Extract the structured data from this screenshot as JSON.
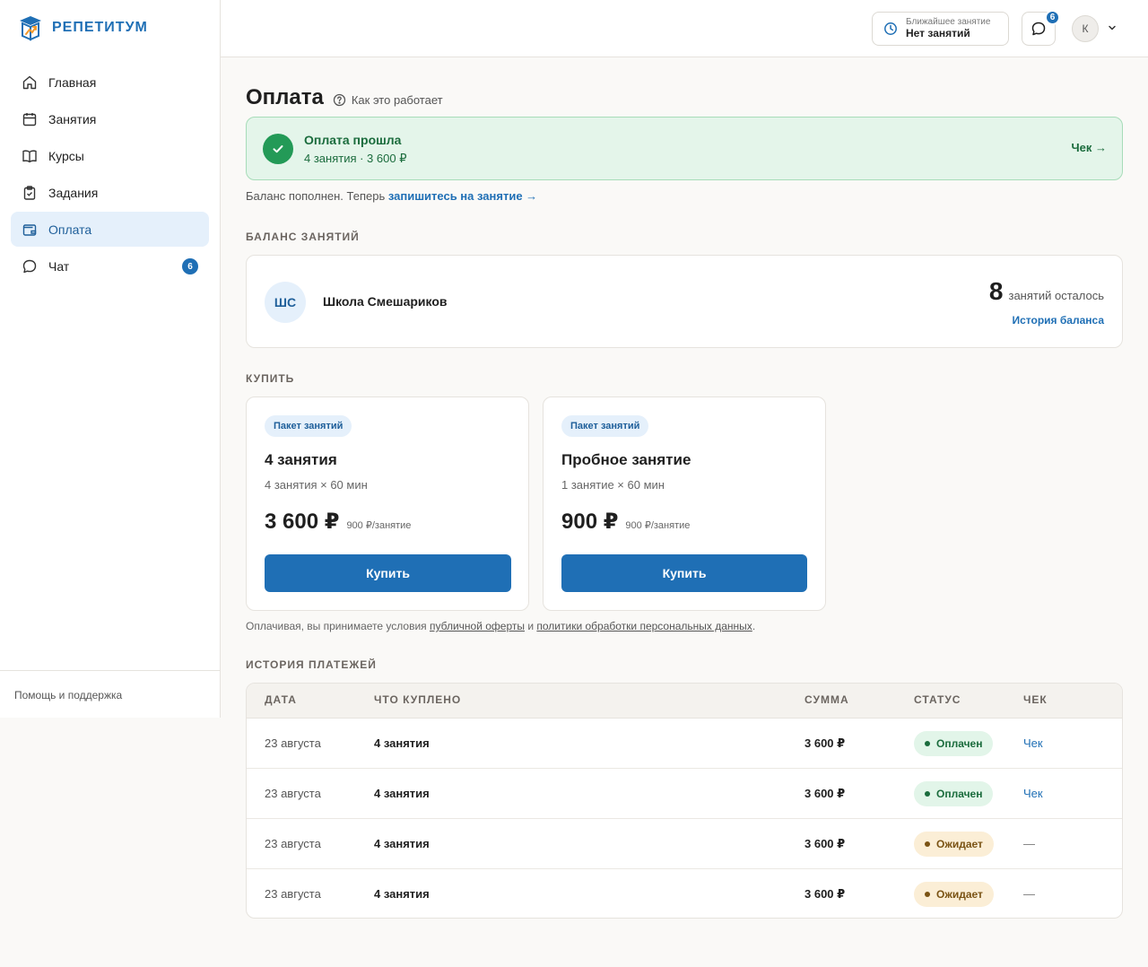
{
  "brand": {
    "name": "РЕПЕТИТУМ",
    "color": "#1f6fb5"
  },
  "sidebar": {
    "items": [
      {
        "label": "Главная",
        "icon": "home-icon"
      },
      {
        "label": "Занятия",
        "icon": "calendar-icon"
      },
      {
        "label": "Курсы",
        "icon": "book-icon"
      },
      {
        "label": "Задания",
        "icon": "clipboard-icon"
      },
      {
        "label": "Оплата",
        "icon": "wallet-icon",
        "active": true
      },
      {
        "label": "Чат",
        "icon": "chat-icon",
        "badge": "6"
      }
    ],
    "footer": "Помощь и поддержка"
  },
  "topbar": {
    "next_lesson_label": "Ближайшее занятие",
    "next_lesson_value": "Нет занятий",
    "chat_badge": "6",
    "avatar_initial": "К"
  },
  "page": {
    "title": "Оплата",
    "how_link": "Как это работает"
  },
  "success": {
    "title": "Оплата прошла",
    "subtitle": "4 занятия · 3 600 ₽",
    "receipt_link": "Чек →"
  },
  "balance_note": {
    "text": "Баланс пополнен. Теперь",
    "link": "запишитесь на занятие →"
  },
  "balance": {
    "section_label": "БАЛАНС ЗАНЯТИЙ",
    "school_initials": "ШС",
    "school_name": "Школа Смешариков",
    "count": "8",
    "count_label": "занятий осталось",
    "history_link": "История баланса"
  },
  "buy": {
    "section_label": "КУПИТЬ",
    "packages": [
      {
        "tag": "Пакет занятий",
        "title": "4 занятия",
        "sub": "4 занятия × 60 мин",
        "price": "3 600 ₽",
        "per": "900 ₽/занятие",
        "button": "Купить"
      },
      {
        "tag": "Пакет занятий",
        "title": "Пробное занятие",
        "sub": "1 занятие × 60 мин",
        "price": "900 ₽",
        "per": "900 ₽/занятие",
        "button": "Купить"
      }
    ],
    "terms_prefix": "Оплачивая, вы принимаете условия",
    "terms_link1": "публичной оферты",
    "terms_and": "и",
    "terms_link2": "политики обработки персональных данных",
    "terms_suffix": "."
  },
  "history": {
    "section_label": "ИСТОРИЯ ПЛАТЕЖЕЙ",
    "columns": [
      "ДАТА",
      "ЧТО КУПЛЕНО",
      "СУММА",
      "СТАТУС",
      "ЧЕК"
    ],
    "rows": [
      {
        "date": "23 августа",
        "item": "4 занятия",
        "sum": "3 600 ₽",
        "status": "Оплачен",
        "check": "Чек"
      },
      {
        "date": "23 августа",
        "item": "4 занятия",
        "sum": "3 600 ₽",
        "status": "Оплачен",
        "check": "Чек"
      },
      {
        "date": "23 августа",
        "item": "4 занятия",
        "sum": "3 600 ₽",
        "status": "Ожидает",
        "check": "—"
      },
      {
        "date": "23 августа",
        "item": "4 занятия",
        "sum": "3 600 ₽",
        "status": "Ожидает",
        "check": "—"
      }
    ]
  },
  "colors": {
    "accent": "#1f6fb5",
    "success": "#239a57",
    "pending": "#7a5314"
  }
}
